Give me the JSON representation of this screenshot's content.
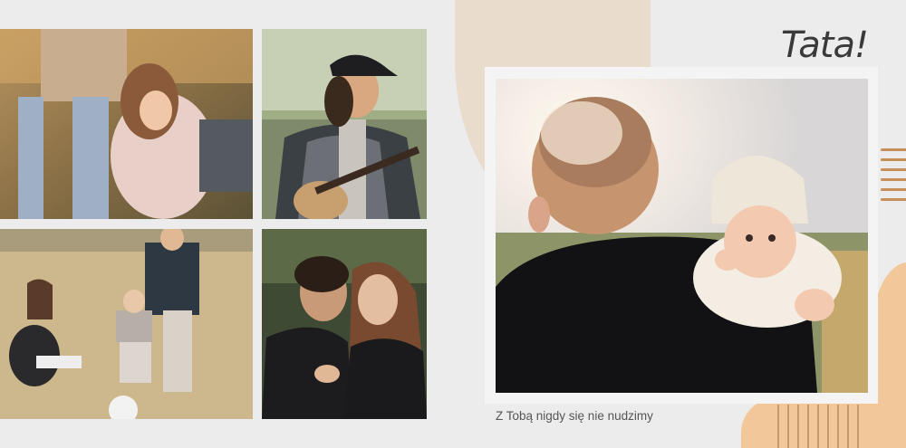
{
  "page": {
    "title": "Tata!",
    "caption": "Z Tobą nigdy się nie nudzimy"
  },
  "photos": [
    {
      "id": "photo-family-walk",
      "desc_icon": "photo-icon"
    },
    {
      "id": "photo-guitar-man",
      "desc_icon": "photo-icon"
    },
    {
      "id": "photo-child-playing",
      "desc_icon": "photo-icon"
    },
    {
      "id": "photo-couple",
      "desc_icon": "photo-icon"
    },
    {
      "id": "photo-father-baby",
      "desc_icon": "photo-icon"
    }
  ],
  "colors": {
    "background": "#ececec",
    "accent_beige": "#e9dccd",
    "accent_orange": "#f2c79a",
    "stripe_brown": "#c78f58"
  }
}
